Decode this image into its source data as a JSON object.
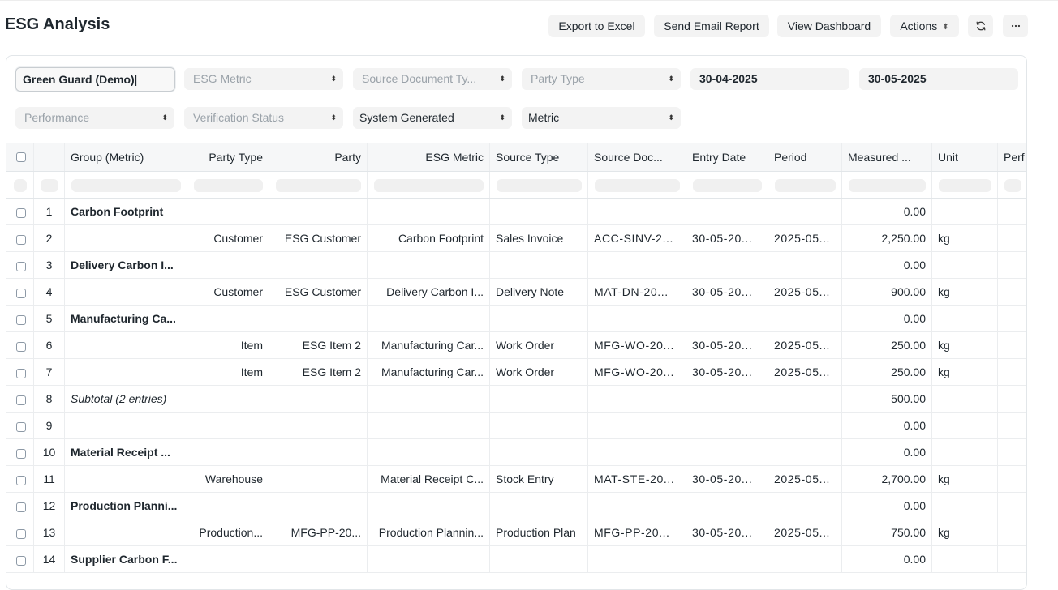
{
  "title": "ESG Analysis",
  "toolbar": {
    "export": "Export to Excel",
    "email": "Send Email Report",
    "dashboard": "View Dashboard",
    "actions": "Actions",
    "refresh_icon": "refresh-icon",
    "more_icon": "ellipsis-icon"
  },
  "filters": {
    "company": "Green Guard (Demo)",
    "esg_metric": "ESG Metric",
    "source_document_type": "Source Document Ty...",
    "party_type": "Party Type",
    "from_date": "30-04-2025",
    "to_date": "30-05-2025",
    "performance": "Performance",
    "verification_status": "Verification Status",
    "entry_type": "System Generated",
    "group_by": "Metric"
  },
  "columns": [
    "Group (Metric)",
    "Party Type",
    "Party",
    "ESG Metric",
    "Source Type",
    "Source Doc...",
    "Entry Date",
    "Period",
    "Measured ...",
    "Unit",
    "Perf"
  ],
  "rows": [
    {
      "n": "1",
      "group": "Carbon Footprint",
      "party_type": "",
      "party": "",
      "metric": "",
      "source_type": "",
      "source_doc": "",
      "entry_date": "",
      "period": "",
      "measured": "0.00",
      "unit": "",
      "style": "group"
    },
    {
      "n": "2",
      "group": "",
      "party_type": "Customer",
      "party": "ESG Customer",
      "metric": "Carbon Footprint",
      "source_type": "Sales Invoice",
      "source_doc": "ACC-SINV-2...",
      "entry_date": "30-05-20...",
      "period": "2025-05...",
      "measured": "2,250.00",
      "unit": "kg",
      "style": "entry"
    },
    {
      "n": "3",
      "group": "Delivery Carbon I...",
      "party_type": "",
      "party": "",
      "metric": "",
      "source_type": "",
      "source_doc": "",
      "entry_date": "",
      "period": "",
      "measured": "0.00",
      "unit": "",
      "style": "group"
    },
    {
      "n": "4",
      "group": "",
      "party_type": "Customer",
      "party": "ESG Customer",
      "metric": "Delivery Carbon I...",
      "source_type": "Delivery Note",
      "source_doc": "MAT-DN-20...",
      "entry_date": "30-05-20...",
      "period": "2025-05...",
      "measured": "900.00",
      "unit": "kg",
      "style": "entry"
    },
    {
      "n": "5",
      "group": "Manufacturing Ca...",
      "party_type": "",
      "party": "",
      "metric": "",
      "source_type": "",
      "source_doc": "",
      "entry_date": "",
      "period": "",
      "measured": "0.00",
      "unit": "",
      "style": "group"
    },
    {
      "n": "6",
      "group": "",
      "party_type": "Item",
      "party": "ESG Item 2",
      "metric": "Manufacturing Car...",
      "source_type": "Work Order",
      "source_doc": "MFG-WO-20...",
      "entry_date": "30-05-20...",
      "period": "2025-05...",
      "measured": "250.00",
      "unit": "kg",
      "style": "entry"
    },
    {
      "n": "7",
      "group": "",
      "party_type": "Item",
      "party": "ESG Item 2",
      "metric": "Manufacturing Car...",
      "source_type": "Work Order",
      "source_doc": "MFG-WO-20...",
      "entry_date": "30-05-20...",
      "period": "2025-05...",
      "measured": "250.00",
      "unit": "kg",
      "style": "entry"
    },
    {
      "n": "8",
      "group": "Subtotal (2 entries)",
      "party_type": "",
      "party": "",
      "metric": "",
      "source_type": "",
      "source_doc": "",
      "entry_date": "",
      "period": "",
      "measured": "500.00",
      "unit": "",
      "style": "subtotal"
    },
    {
      "n": "9",
      "group": "",
      "party_type": "",
      "party": "",
      "metric": "",
      "source_type": "",
      "source_doc": "",
      "entry_date": "",
      "period": "",
      "measured": "0.00",
      "unit": "",
      "style": "entry"
    },
    {
      "n": "10",
      "group": "Material Receipt ...",
      "party_type": "",
      "party": "",
      "metric": "",
      "source_type": "",
      "source_doc": "",
      "entry_date": "",
      "period": "",
      "measured": "0.00",
      "unit": "",
      "style": "group"
    },
    {
      "n": "11",
      "group": "",
      "party_type": "Warehouse",
      "party": "",
      "metric": "Material Receipt C...",
      "source_type": "Stock Entry",
      "source_doc": "MAT-STE-20...",
      "entry_date": "30-05-20...",
      "period": "2025-05...",
      "measured": "2,700.00",
      "unit": "kg",
      "style": "entry"
    },
    {
      "n": "12",
      "group": "Production Planni...",
      "party_type": "",
      "party": "",
      "metric": "",
      "source_type": "",
      "source_doc": "",
      "entry_date": "",
      "period": "",
      "measured": "0.00",
      "unit": "",
      "style": "group"
    },
    {
      "n": "13",
      "group": "",
      "party_type": "Production...",
      "party": "MFG-PP-20...",
      "metric": "Production Plannin...",
      "source_type": "Production Plan",
      "source_doc": "MFG-PP-20...",
      "entry_date": "30-05-20...",
      "period": "2025-05...",
      "measured": "750.00",
      "unit": "kg",
      "style": "entry"
    },
    {
      "n": "14",
      "group": "Supplier Carbon F...",
      "party_type": "",
      "party": "",
      "metric": "",
      "source_type": "",
      "source_doc": "",
      "entry_date": "",
      "period": "",
      "measured": "0.00",
      "unit": "",
      "style": "group"
    }
  ]
}
